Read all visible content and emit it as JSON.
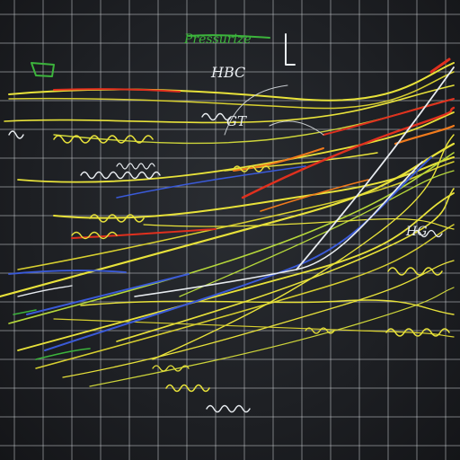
{
  "labels": {
    "title_scribble": "Pressurize",
    "top_mark": "HBC",
    "mid_mark": "GT",
    "right_mark": "HG"
  },
  "colors": {
    "background": "#1e2024",
    "grid": "#c8ccd0",
    "yellow": "#e8e23a",
    "yellow_green": "#b6d83a",
    "red": "#e0301e",
    "orange": "#f07a1c",
    "blue": "#3a5ad8",
    "light_blue": "#8aa6e6",
    "white": "#e8ecf0",
    "green": "#3cb43c"
  },
  "icons": [
    "graph-grid",
    "hand-drawn-lines"
  ]
}
